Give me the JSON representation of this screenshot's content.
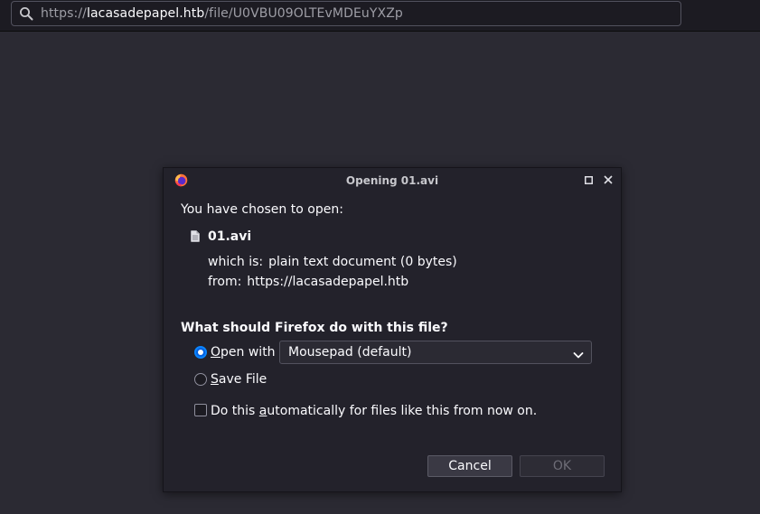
{
  "browser": {
    "url": {
      "scheme": "https://",
      "host": "lacasadepapel.htb",
      "path": "/file/U0VBU09OLTEvMDEuYXZp"
    },
    "icons": {
      "url_search": "search-icon"
    }
  },
  "dialog": {
    "title": "Opening 01.avi",
    "icons": {
      "logo": "firefox-logo-icon",
      "maximize": "maximize-icon",
      "close": "close-icon",
      "file": "file-icon",
      "dropdown": "chevron-down-icon"
    },
    "chosen_label": "You have chosen to open:",
    "file_name": "01.avi",
    "type_key": "which is:",
    "type_value": "plain text document (0 bytes)",
    "from_key": "from:",
    "from_value": "https://lacasadepapel.htb",
    "question": "What should Firefox do with this file?",
    "open_with": {
      "accesskey": "O",
      "rest": "pen with",
      "selected": true,
      "app": "Mousepad (default)"
    },
    "save_file": {
      "accesskey": "S",
      "rest": "ave File",
      "selected": false
    },
    "auto_checkbox": {
      "before": "Do this ",
      "accesskey": "a",
      "after": "utomatically for files like this from now on.",
      "checked": false
    },
    "buttons": {
      "cancel": "Cancel",
      "ok": "OK"
    }
  },
  "colors": {
    "page_bg": "#2b2a33",
    "dialog_bg": "#23222b",
    "accent": "#0060df"
  }
}
